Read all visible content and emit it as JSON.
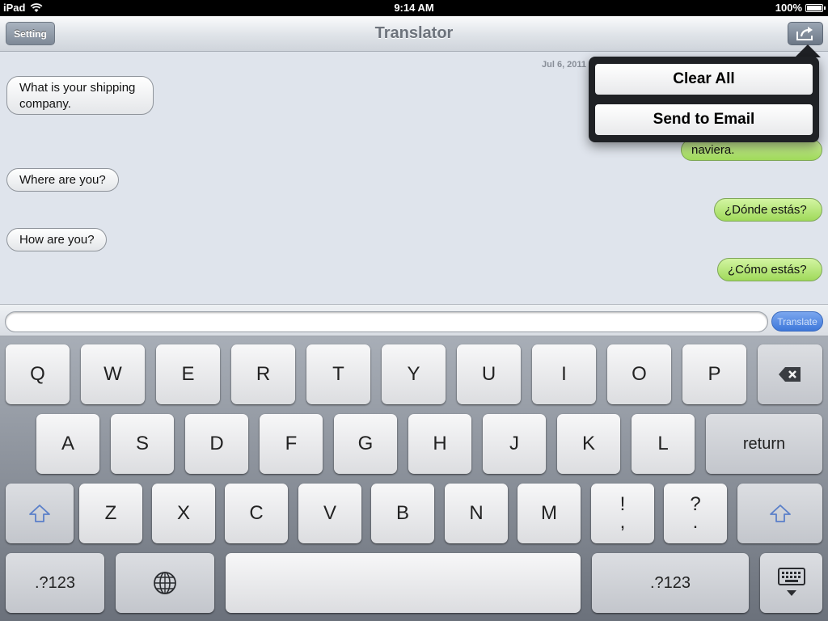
{
  "status_bar": {
    "device": "iPad",
    "time": "9:14 AM",
    "battery": "100%"
  },
  "navbar": {
    "title": "Translator",
    "setting_label": "Setting",
    "share_icon": "share-icon"
  },
  "chat": {
    "date": "Jul 6, 2011",
    "incoming": [
      "What is your shipping company.",
      "Where are you?",
      "How are you?"
    ],
    "outgoing": [
      "naviera.",
      "¿Dónde estás?",
      "¿Cómo estás?"
    ]
  },
  "input": {
    "value": "",
    "placeholder": "",
    "translate_label": "Translate"
  },
  "popover": {
    "clear_all": "Clear All",
    "send_email": "Send to Email"
  },
  "keyboard": {
    "row1": [
      "Q",
      "W",
      "E",
      "R",
      "T",
      "Y",
      "U",
      "I",
      "O",
      "P"
    ],
    "row2": [
      "A",
      "S",
      "D",
      "F",
      "G",
      "H",
      "J",
      "K",
      "L"
    ],
    "row3": [
      "Z",
      "X",
      "C",
      "V",
      "B",
      "N",
      "M"
    ],
    "return_label": "return",
    "numbers_label": ".?123",
    "punct1_top": "!",
    "punct1_bottom": ",",
    "punct2_top": "?",
    "punct2_bottom": ".",
    "icons": {
      "backspace": "backspace-icon",
      "shift": "shift-icon",
      "globe": "globe-icon",
      "hide": "keyboard-hide-icon"
    }
  },
  "colors": {
    "outgoing_bubble": "#9fd95a",
    "incoming_bubble": "#f2f3f5",
    "translate_button": "#3e78da",
    "navbar": "#dfe3e8"
  }
}
